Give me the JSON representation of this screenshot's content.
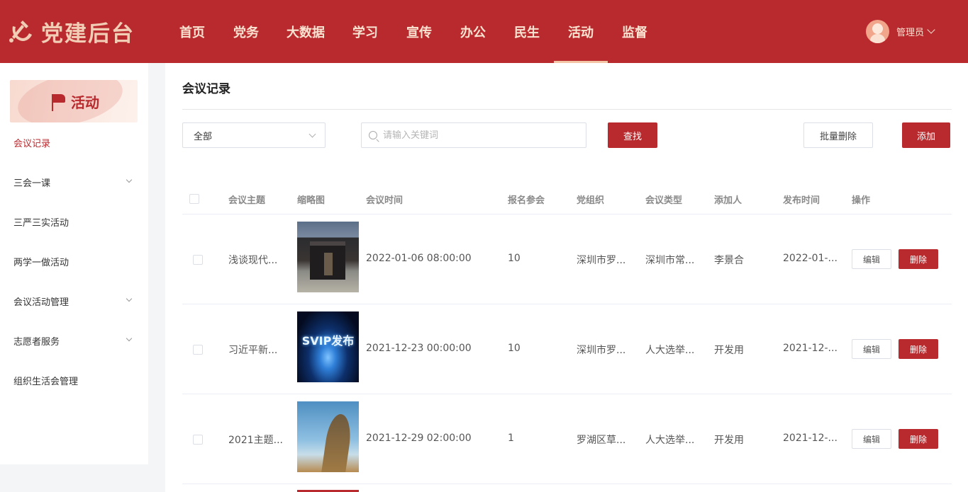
{
  "app": {
    "logo_text": "党建后台",
    "brand_color": "#b92a2e"
  },
  "nav": {
    "items": [
      "首页",
      "党务",
      "大数据",
      "学习",
      "宣传",
      "办公",
      "民生",
      "活动",
      "监督"
    ],
    "active": "活动"
  },
  "user": {
    "name": "管理员"
  },
  "sidebar": {
    "banner_title": "活动",
    "items": [
      {
        "label": "会议记录",
        "active": true,
        "expandable": false
      },
      {
        "label": "三会一课",
        "active": false,
        "expandable": true
      },
      {
        "label": "三严三实活动",
        "active": false,
        "expandable": false
      },
      {
        "label": "两学一做活动",
        "active": false,
        "expandable": false
      },
      {
        "label": "会议活动管理",
        "active": false,
        "expandable": true
      },
      {
        "label": "志愿者服务",
        "active": false,
        "expandable": true
      },
      {
        "label": "组织生活会管理",
        "active": false,
        "expandable": false
      }
    ]
  },
  "main": {
    "page_title": "会议记录",
    "filter_value": "全部",
    "search_placeholder": "请输入关键词",
    "search_button": "查找",
    "batch_delete_button": "批量删除",
    "add_button": "添加"
  },
  "table": {
    "columns": [
      "会议主题",
      "缩略图",
      "会议时间",
      "报名参会",
      "党组织",
      "会议类型",
      "添加人",
      "发布时间",
      "操作"
    ],
    "rows": [
      {
        "topic": "浅谈现代...",
        "thumb": "building-photo",
        "time": "2022-01-06 08:00:00",
        "signups": "10",
        "org": "深圳市罗...",
        "type": "深圳市常...",
        "creator": "李景合",
        "published": "2022-01-..."
      },
      {
        "topic": "习近平新...",
        "thumb": "svip-poster",
        "thumb_text": "SVIP发布",
        "time": "2021-12-23 00:00:00",
        "signups": "10",
        "org": "深圳市罗...",
        "type": "人大选举...",
        "creator": "开发用",
        "published": "2021-12-..."
      },
      {
        "topic": "2021主题...",
        "thumb": "mountain-photo",
        "time": "2021-12-29 02:00:00",
        "signups": "1",
        "org": "罗湖区草...",
        "type": "人大选举...",
        "creator": "开发用",
        "published": "2021-12-..."
      }
    ],
    "edit_label": "编辑",
    "delete_label": "删除"
  }
}
